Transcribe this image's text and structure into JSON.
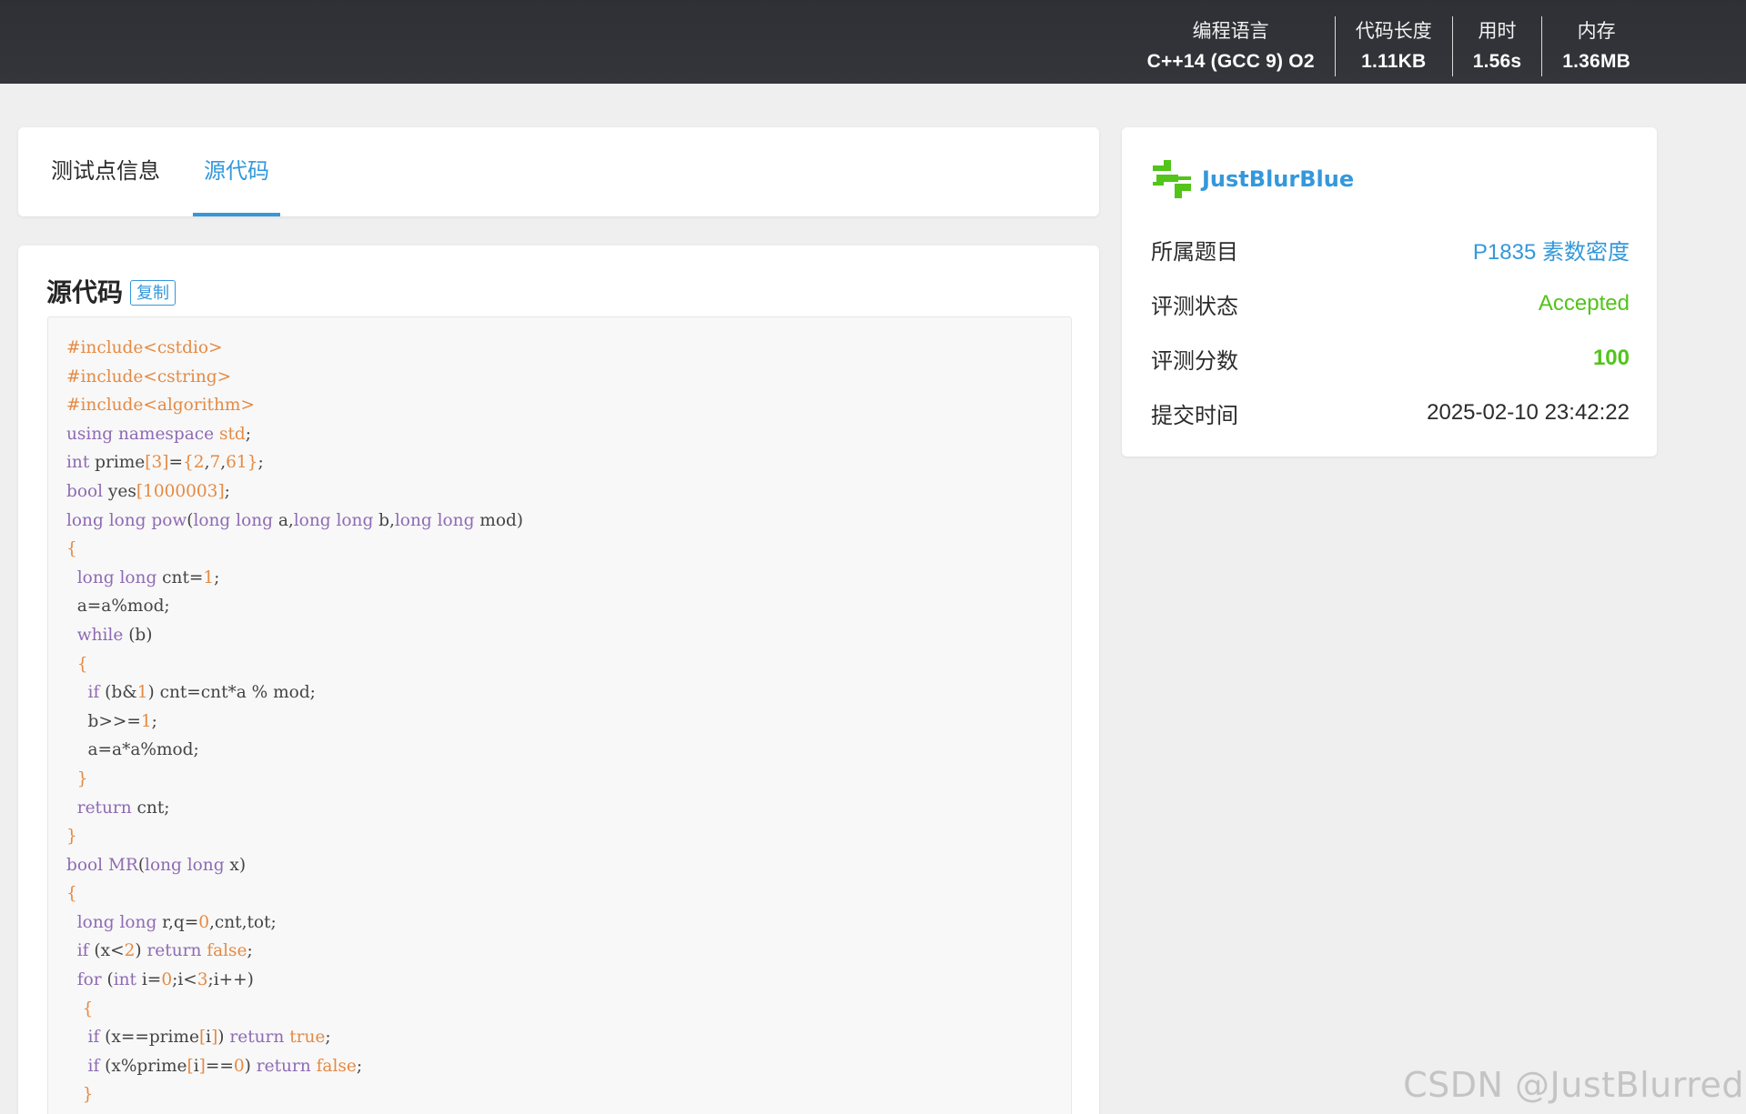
{
  "header": {
    "stats": [
      {
        "label": "编程语言",
        "value": "C++14 (GCC 9) O2"
      },
      {
        "label": "代码长度",
        "value": "1.11KB"
      },
      {
        "label": "用时",
        "value": "1.56s"
      },
      {
        "label": "内存",
        "value": "1.36MB"
      }
    ]
  },
  "tabs": [
    {
      "label": "测试点信息",
      "active": false
    },
    {
      "label": "源代码",
      "active": true
    }
  ],
  "code_section": {
    "title": "源代码",
    "copy_label": "复制",
    "lines": [
      "#include<cstdio>",
      "#include<cstring>",
      "#include<algorithm>",
      "using namespace std;",
      "int prime[3]={2,7,61};",
      "bool yes[1000003];",
      "long long pow(long long a,long long b,long long mod)",
      "{",
      "  long long cnt=1;",
      "  a=a%mod;",
      "  while (b)",
      "  {",
      "    if (b&1) cnt=cnt*a % mod;",
      "    b>>=1;",
      "    a=a*a%mod;",
      "  }",
      "  return cnt;",
      "}",
      "bool MR(long long x)",
      "{",
      "  long long r,q=0,cnt,tot;",
      "  if (x<2) return false;",
      "  for (int i=0;i<3;i++)",
      "   {",
      "    if (x==prime[i]) return true;",
      "    if (x%prime[i]==0) return false;",
      "   }"
    ]
  },
  "info": {
    "username": "JustBlurBlue",
    "logo_icon": "user-logo-icon",
    "rows": [
      {
        "label": "所属题目",
        "value": "P1835 素数密度"
      },
      {
        "label": "评测状态",
        "value": "Accepted"
      },
      {
        "label": "评测分数",
        "value": "100"
      },
      {
        "label": "提交时间",
        "value": "2025-02-10 23:42:22"
      }
    ]
  },
  "watermark": "CSDN @JustBlurred",
  "colors": {
    "accent": "#3498db",
    "success": "#52c41a",
    "header_bg": "#323337",
    "keyword": "#8e6bb3",
    "literal": "#e58a43"
  }
}
